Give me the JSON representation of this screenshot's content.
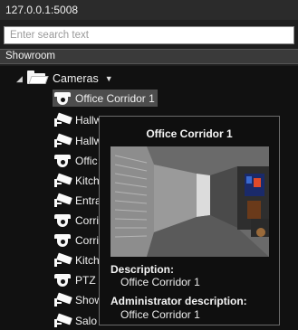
{
  "window": {
    "title": "127.0.0.1:5008"
  },
  "search": {
    "placeholder": "Enter search text",
    "value": ""
  },
  "site": {
    "name": "Showroom"
  },
  "tree": {
    "folder": {
      "label": "Cameras",
      "icon": "folder-open-icon",
      "expander_icon": "triangle-down-icon",
      "menu_icon": "dropdown-arrow-icon"
    },
    "cameras": [
      {
        "label": "Office Corridor 1",
        "icon": "dome-camera-icon",
        "selected": true
      },
      {
        "label": "Hallw",
        "icon": "bullet-camera-icon"
      },
      {
        "label": "Hallw",
        "icon": "bullet-camera-icon"
      },
      {
        "label": "Offic",
        "icon": "dome-camera-icon"
      },
      {
        "label": "Kitch",
        "icon": "bullet-camera-icon"
      },
      {
        "label": "Entra",
        "icon": "bullet-camera-icon"
      },
      {
        "label": "Corri",
        "icon": "dome-camera-icon"
      },
      {
        "label": "Corri",
        "icon": "dome-camera-icon"
      },
      {
        "label": "Kitch",
        "icon": "bullet-camera-icon"
      },
      {
        "label": "PTZ",
        "icon": "dome-camera-icon"
      },
      {
        "label": "Show",
        "icon": "bullet-camera-icon"
      },
      {
        "label": "Salo",
        "icon": "bullet-camera-icon"
      }
    ]
  },
  "tooltip": {
    "title": "Office Corridor 1",
    "description_label": "Description:",
    "description_value": "Office Corridor 1",
    "admin_description_label": "Administrator description:",
    "admin_description_value": "Office Corridor 1"
  },
  "colors": {
    "background": "#111111",
    "header_bar": "#2b2b2b",
    "site_bar": "#3a3a3a",
    "selected_row": "#4d4d4d",
    "tooltip_border": "#6b6b6b"
  }
}
